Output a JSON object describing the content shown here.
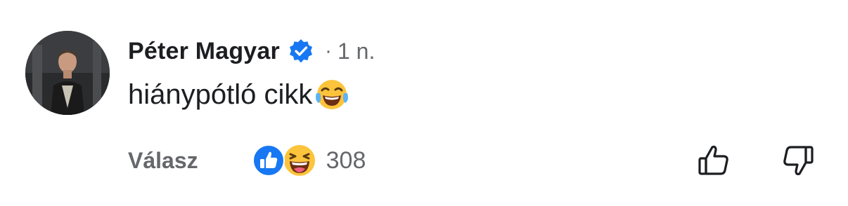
{
  "comment": {
    "author": "Péter Magyar",
    "verified_icon": "verified-badge-icon",
    "separator": "·",
    "time": "1 n.",
    "text": "hiánypótló cikk",
    "inline_emoji": "face-with-tears-of-joy",
    "reply_label": "Válasz",
    "reactions": {
      "types": [
        "like",
        "haha"
      ],
      "count": "308"
    },
    "upvote_icon": "thumbs-up-outline-icon",
    "downvote_icon": "thumbs-down-outline-icon"
  },
  "colors": {
    "primary_text": "#1c1e21",
    "secondary_text": "#65676b",
    "verified_blue": "#1877f2",
    "like_blue": "#1877f2",
    "emoji_yellow": "#fcc43c"
  }
}
